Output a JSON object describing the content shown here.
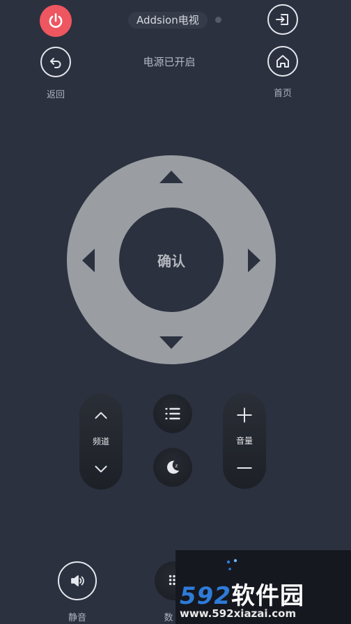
{
  "header": {
    "device_name": "Addsion电视",
    "status_text": "电源已开启"
  },
  "buttons": {
    "power": {
      "icon": "power-icon"
    },
    "input": {
      "icon": "input-source-icon"
    },
    "back": {
      "icon": "back-arrow-icon",
      "label": "返回"
    },
    "home": {
      "icon": "home-icon",
      "label": "首页"
    }
  },
  "dpad": {
    "ok_label": "确认"
  },
  "controls": {
    "channel_label": "频道",
    "volume_label": "音量",
    "menu_icon": "menu-list-icon",
    "sleep_icon": "sleep-moon-icon"
  },
  "bottom": {
    "mute_label": "静音",
    "numpad_label": "数"
  },
  "watermark": {
    "brand_digits": "592",
    "brand_cn": "软件园",
    "url": "www.592xiazai.com"
  },
  "colors": {
    "background": "#2b313f",
    "power": "#ee5660",
    "dpad": "#9a9da2"
  }
}
